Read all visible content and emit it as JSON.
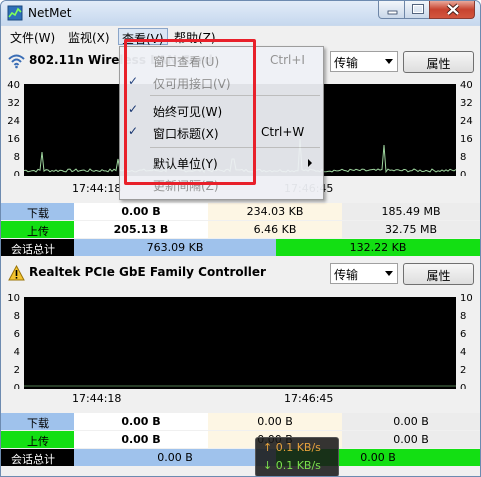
{
  "window": {
    "title": "NetMet"
  },
  "menu": {
    "file": "文件(W)",
    "monitor": "监视(X)",
    "view": "查看(V)",
    "help": "帮助(Z)"
  },
  "view_menu": {
    "items": [
      {
        "label": "窗口查看(U)",
        "shortcut": "Ctrl+I",
        "checked": false,
        "enabled": false
      },
      {
        "label": "仅可用接口(V)",
        "shortcut": "",
        "checked": true,
        "enabled": false
      },
      {
        "label": "始终可见(W)",
        "shortcut": "",
        "checked": true,
        "enabled": true
      },
      {
        "label": "窗口标题(X)",
        "shortcut": "Ctrl+W",
        "checked": true,
        "enabled": true
      },
      {
        "label": "默认单位(Y)",
        "shortcut": "",
        "checked": false,
        "enabled": true,
        "submenu": true
      },
      {
        "label": "更新间隔(Z)",
        "shortcut": "",
        "checked": false,
        "enabled": false
      }
    ],
    "check_glyph": "✓"
  },
  "interfaces": [
    {
      "name": "802.11n Wireless LAN Card",
      "icon": "wifi-icon",
      "mode": "传输",
      "properties_label": "属性",
      "y_ticks": [
        "40",
        "32",
        "24",
        "16",
        "8",
        "0"
      ],
      "time_labels": [
        "17:44:18",
        "17:46:45"
      ],
      "stats": {
        "download_label": "下载",
        "upload_label": "上传",
        "total_label": "会话总计",
        "download": [
          "0.00 B",
          "234.03 KB",
          "185.49 MB"
        ],
        "upload": [
          "205.13 B",
          "6.46 KB",
          "32.75 MB"
        ],
        "total": [
          "763.09 KB",
          "132.22 KB"
        ]
      }
    },
    {
      "name": "Realtek PCIe GbE Family Controller",
      "icon": "warning-icon",
      "mode": "传输",
      "properties_label": "属性",
      "y_ticks": [
        "10",
        "8",
        "6",
        "4",
        "2",
        "0"
      ],
      "time_labels": [
        "17:44:18",
        "17:46:45"
      ],
      "stats": {
        "download_label": "下载",
        "upload_label": "上传",
        "total_label": "会话总计",
        "download": [
          "0.00 B",
          "0.00 B",
          "0.00 B"
        ],
        "upload": [
          "0.00 B",
          "0.00 B",
          "0.00 B"
        ],
        "total": [
          "0.00 B",
          "0.00 B"
        ]
      }
    }
  ],
  "speed_widget": {
    "up": "↑ 0.1 KB/s",
    "down": "↓ 0.1 KB/s"
  },
  "colors": {
    "download": "#9fc2ec",
    "upload": "#13df13",
    "graph_bg": "#000000",
    "highlight": "#e8202a"
  }
}
